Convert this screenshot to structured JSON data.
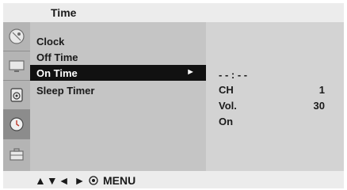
{
  "header": {
    "title": "Time"
  },
  "sidebar": {
    "icons": [
      {
        "name": "satellite-dish-icon"
      },
      {
        "name": "monitor-icon"
      },
      {
        "name": "speaker-icon"
      },
      {
        "name": "clock-icon",
        "active": true
      },
      {
        "name": "briefcase-icon"
      }
    ]
  },
  "menu": {
    "items": [
      {
        "label": "Clock"
      },
      {
        "label": "Off Time"
      },
      {
        "label": "On Time",
        "selected": true,
        "arrow": "►"
      },
      {
        "label": "Sleep Timer"
      }
    ]
  },
  "on_time_panel": {
    "time_value": "- - : - -",
    "ch_label": "CH",
    "ch_value": "1",
    "vol_label": "Vol.",
    "vol_value": "30",
    "state": "On"
  },
  "footer": {
    "nav_glyphs": "▲▼◄ ►",
    "ok_icon": "ok-button-icon",
    "menu_label": "MENU"
  },
  "colors": {
    "highlight_bg": "#111111",
    "panel_bg": "#c5c5c5",
    "right_panel_bg": "#d3d3d3",
    "bar_bg": "#ececec"
  }
}
